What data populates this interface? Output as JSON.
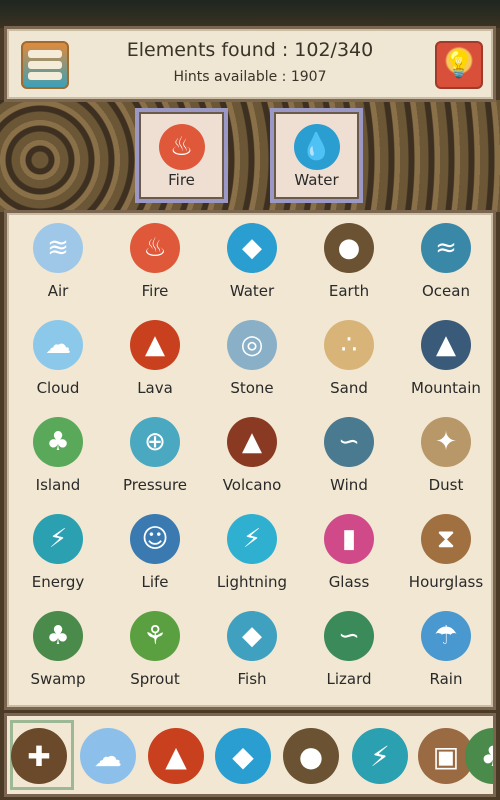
{
  "header": {
    "elements_found_label": "Elements found : 102/340",
    "hints_label": "Hints available : 1907",
    "menu_icon": "element-list-icon",
    "hint_icon": "lightbulb-icon"
  },
  "selected": [
    {
      "label": "Fire",
      "icon": "fire-icon",
      "color": "#e0583a",
      "glyph": "♨"
    },
    {
      "label": "Water",
      "icon": "water-drop-icon",
      "color": "#2a9ed0",
      "glyph": "💧"
    }
  ],
  "elements": [
    {
      "label": "Air",
      "color": "#9fc8e8",
      "glyph": "≋"
    },
    {
      "label": "Fire",
      "color": "#e0583a",
      "glyph": "♨"
    },
    {
      "label": "Water",
      "color": "#2a9ed0",
      "glyph": "◆"
    },
    {
      "label": "Earth",
      "color": "#6a5232",
      "glyph": "●"
    },
    {
      "label": "Ocean",
      "color": "#3a88a8",
      "glyph": "≈"
    },
    {
      "label": "Cloud",
      "color": "#8cc8ea",
      "glyph": "☁"
    },
    {
      "label": "Lava",
      "color": "#c8401e",
      "glyph": "▲"
    },
    {
      "label": "Stone",
      "color": "#8ab0c8",
      "glyph": "◎"
    },
    {
      "label": "Sand",
      "color": "#d8b478",
      "glyph": "∴"
    },
    {
      "label": "Mountain",
      "color": "#3a5a7a",
      "glyph": "▲"
    },
    {
      "label": "Island",
      "color": "#5aa85a",
      "glyph": "♣"
    },
    {
      "label": "Pressure",
      "color": "#4aa8c0",
      "glyph": "⊕"
    },
    {
      "label": "Volcano",
      "color": "#8a3a22",
      "glyph": "▲"
    },
    {
      "label": "Wind",
      "color": "#4a7a90",
      "glyph": "∽"
    },
    {
      "label": "Dust",
      "color": "#b89868",
      "glyph": "✦"
    },
    {
      "label": "Energy",
      "color": "#2aa0b0",
      "glyph": "⚡"
    },
    {
      "label": "Life",
      "color": "#3a7ab0",
      "glyph": "☺"
    },
    {
      "label": "Lightning",
      "color": "#30b0d0",
      "glyph": "⚡"
    },
    {
      "label": "Glass",
      "color": "#d04a8a",
      "glyph": "▮"
    },
    {
      "label": "Hourglass",
      "color": "#a07040",
      "glyph": "⧗"
    },
    {
      "label": "Swamp",
      "color": "#4a8a4a",
      "glyph": "♣"
    },
    {
      "label": "Sprout",
      "color": "#5aa040",
      "glyph": "⚘"
    },
    {
      "label": "Fish",
      "color": "#40a0c0",
      "glyph": "◆"
    },
    {
      "label": "Lizard",
      "color": "#3a8a5a",
      "glyph": "∽"
    },
    {
      "label": "Rain",
      "color": "#4a98d0",
      "glyph": "☂"
    }
  ],
  "toolbar": [
    {
      "icon": "all-elements-icon",
      "color": "#6a4a2a",
      "glyph": "✚"
    },
    {
      "icon": "air-icon",
      "color": "#8cc0ea",
      "glyph": "☁"
    },
    {
      "icon": "lava-icon",
      "color": "#c8401e",
      "glyph": "▲"
    },
    {
      "icon": "water-icon",
      "color": "#2a9ed0",
      "glyph": "◆"
    },
    {
      "icon": "earth-icon",
      "color": "#6a5232",
      "glyph": "●"
    },
    {
      "icon": "energy-icon",
      "color": "#2aa0b0",
      "glyph": "⚡"
    },
    {
      "icon": "tools-icon",
      "color": "#9a6a42",
      "glyph": "▣"
    },
    {
      "icon": "plant-icon",
      "color": "#4a8a4a",
      "glyph": "♣"
    }
  ]
}
